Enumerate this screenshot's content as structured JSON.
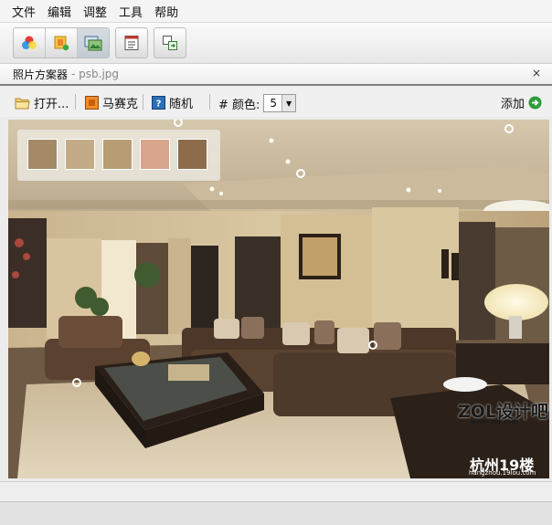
{
  "menu": [
    "文件",
    "编辑",
    "调整",
    "工具",
    "帮助"
  ],
  "panel": {
    "title": "照片方案器",
    "file": " - psb.jpg",
    "close": "×"
  },
  "actions": {
    "open": "打开...",
    "mosaic": "马赛克",
    "random": "随机",
    "colors_label": "# 颜色:",
    "colors_value": "5",
    "add": "添加"
  },
  "palette": [
    "#a48a66",
    "#c2ab86",
    "#b69d74",
    "#d7a58b",
    "#8c6c4b"
  ],
  "watermarks": {
    "brand": "ZOL设计吧",
    "site": "www.zol.com",
    "city": "杭州19楼",
    "domain": "hangzhou.19lou.com"
  }
}
